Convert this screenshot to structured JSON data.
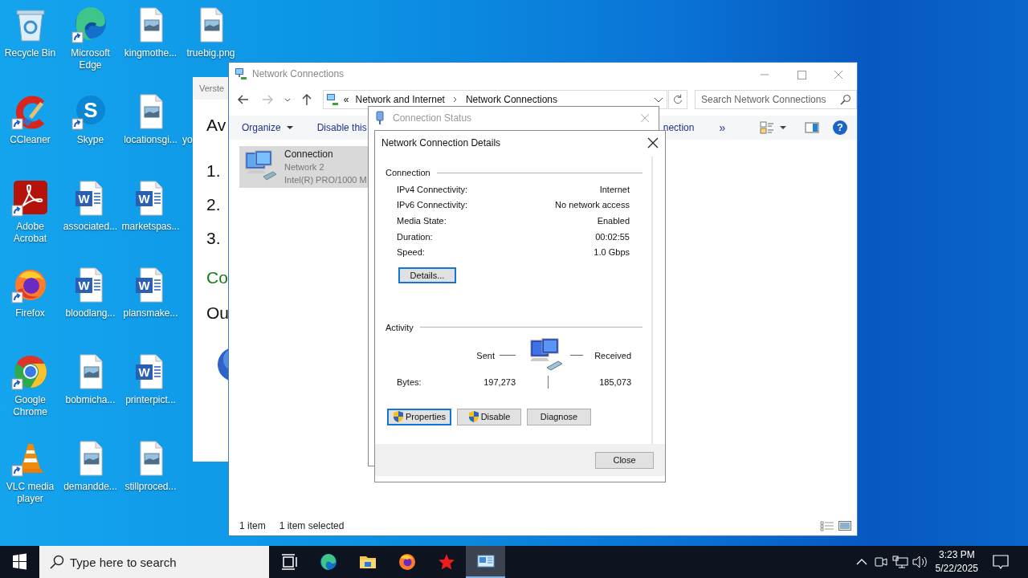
{
  "desktop": {
    "icons": [
      {
        "label": "Recycle Bin",
        "kind": "recycle",
        "shortcut": false
      },
      {
        "label": "CCleaner",
        "kind": "ccleaner",
        "shortcut": true
      },
      {
        "label": "Adobe Acrobat",
        "kind": "acrobat",
        "shortcut": true
      },
      {
        "label": "Firefox",
        "kind": "firefox",
        "shortcut": true
      },
      {
        "label": "Google Chrome",
        "kind": "chrome",
        "shortcut": true
      },
      {
        "label": "VLC media player",
        "kind": "vlc",
        "shortcut": true
      },
      {
        "label": "Microsoft Edge",
        "kind": "edge",
        "shortcut": true
      },
      {
        "label": "Skype",
        "kind": "skype",
        "shortcut": true,
        "glyph": "S"
      },
      {
        "label": "associated...",
        "kind": "word",
        "shortcut": false,
        "glyph": "W"
      },
      {
        "label": "bloodlang...",
        "kind": "word",
        "shortcut": false,
        "glyph": "W"
      },
      {
        "label": "bobmicha...",
        "kind": "image",
        "shortcut": false
      },
      {
        "label": "demandde...",
        "kind": "image",
        "shortcut": false
      },
      {
        "label": "kingmothe...",
        "kind": "image",
        "shortcut": false
      },
      {
        "label": "locationsgi...",
        "kind": "image",
        "shortcut": false
      },
      {
        "label": "marketspas...",
        "kind": "word",
        "shortcut": false,
        "glyph": "W"
      },
      {
        "label": "plansmake...",
        "kind": "word",
        "shortcut": false,
        "glyph": "W"
      },
      {
        "label": "printerpict...",
        "kind": "word",
        "shortcut": false,
        "glyph": "W"
      },
      {
        "label": "stillproced...",
        "kind": "image",
        "shortcut": false
      },
      {
        "label": "truebig.png",
        "kind": "image",
        "shortcut": false
      },
      {
        "label": "yo",
        "kind": "covered"
      }
    ]
  },
  "background_window": {
    "title": "Verste",
    "lines": [
      {
        "text": "Av",
        "kind": "heading"
      },
      {
        "text": "1.",
        "kind": "step"
      },
      {
        "text": "2.",
        "kind": "step"
      },
      {
        "text": "3.",
        "kind": "step"
      },
      {
        "text": "Co",
        "kind": "green"
      },
      {
        "text": "Ou",
        "kind": "heading"
      }
    ]
  },
  "explorer": {
    "title": "Network Connections",
    "active": false,
    "address": {
      "overflow": "«",
      "crumbs": [
        "Network and Internet",
        "Network Connections"
      ]
    },
    "search": {
      "placeholder": "Search Network Connections"
    },
    "commands": [
      {
        "label": "Organize",
        "dropdown": true
      },
      {
        "label": "Disable this",
        "dropdown": false
      },
      {
        "label": "nection",
        "dropdown": false
      }
    ],
    "more": "»",
    "help": "?",
    "items": [
      {
        "name": "Connection",
        "network": "Network 2",
        "device": "Intel(R) PRO/1000 M",
        "selected": true
      }
    ],
    "status": {
      "count": "1 item",
      "selection": "1 item selected"
    }
  },
  "status_dialog": {
    "title": "Connection Status",
    "active": false
  },
  "details_dialog": {
    "title": "Network Connection Details",
    "connection": {
      "heading": "Connection",
      "rows": [
        {
          "label": "IPv4 Connectivity:",
          "value": "Internet"
        },
        {
          "label": "IPv6 Connectivity:",
          "value": "No network access"
        },
        {
          "label": "Media State:",
          "value": "Enabled"
        },
        {
          "label": "Duration:",
          "value": "00:02:55"
        },
        {
          "label": "Speed:",
          "value": "1.0 Gbps"
        }
      ]
    },
    "details_button": {
      "label": "Details...",
      "focused": true
    },
    "activity": {
      "heading": "Activity",
      "sent_label": "Sent",
      "received_label": "Received",
      "bytes_label": "Bytes:",
      "sent": "197,273",
      "received": "185,073"
    },
    "buttons": [
      {
        "label": "Properties",
        "shield": true,
        "focused": true
      },
      {
        "label": "Disable",
        "shield": true,
        "focused": false
      },
      {
        "label": "Diagnose",
        "shield": false,
        "focused": false
      }
    ],
    "close_button": "Close"
  },
  "taskbar": {
    "search": {
      "placeholder": "Type here to search"
    },
    "apps": [
      {
        "kind": "taskview",
        "active": false
      },
      {
        "kind": "edge",
        "active": false
      },
      {
        "kind": "folder",
        "active": false
      },
      {
        "kind": "firefox",
        "active": false
      },
      {
        "kind": "star",
        "active": false
      },
      {
        "kind": "network",
        "active": true
      }
    ],
    "clock": {
      "time": "3:23 PM",
      "date": "5/22/2025"
    }
  }
}
